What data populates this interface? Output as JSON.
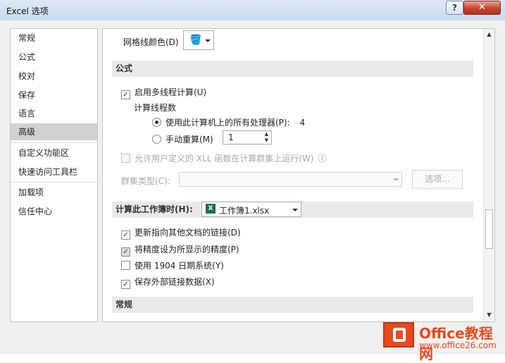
{
  "window": {
    "title": "Excel 选项",
    "help_glyph": "?",
    "close_glyph": "✕"
  },
  "sidebar": {
    "items": [
      {
        "label": "常规",
        "selected": false
      },
      {
        "label": "公式",
        "selected": false
      },
      {
        "label": "校对",
        "selected": false
      },
      {
        "label": "保存",
        "selected": false
      },
      {
        "label": "语言",
        "selected": false
      },
      {
        "label": "高级",
        "selected": true
      },
      {
        "label": "自定义功能区",
        "selected": false
      },
      {
        "label": "快速访问工具栏",
        "selected": false
      },
      {
        "label": "加载项",
        "selected": false
      },
      {
        "label": "信任中心",
        "selected": false
      }
    ]
  },
  "content": {
    "gridline_color_label": "网格线颜色(D)",
    "formula_section": "公式",
    "enable_multithread": {
      "label": "启用多线程计算(U)",
      "checked": true
    },
    "thread_count_label": "计算线程数",
    "use_all_processors": {
      "label": "使用此计算机上的所有处理器(P):",
      "value": "4",
      "selected": true
    },
    "manual": {
      "label": "手动重算(M)",
      "value": "1",
      "selected": false
    },
    "allow_xll": {
      "label": "允许用户定义的 XLL 函数在计算群集上运行(W)",
      "checked": false,
      "info_glyph": "ⓘ"
    },
    "cluster_type_label": "群集类型(C):",
    "options_button": "选项...",
    "workbook_section_label": "计算此工作簿时(H):",
    "workbook_select": "工作簿1.xlsx",
    "update_links": {
      "label": "更新指向其他文档的链接(D)",
      "checked": true
    },
    "set_precision": {
      "label": "将精度设为所显示的精度(P)",
      "checked": true
    },
    "date_1904": {
      "label": "使用 1904 日期系统(Y)",
      "checked": false
    },
    "save_external": {
      "label": "保存外部链接数据(X)",
      "checked": true
    },
    "general_section": "常规"
  },
  "scrollbar": {
    "up_glyph": "▲",
    "down_glyph": "▼"
  },
  "watermark": {
    "brand": "Office教程网",
    "url": "www.office26.com"
  },
  "colors": {
    "accent": "#e8491d",
    "selected_nav": "#d1d1d1",
    "section_bg": "#e9e9e9"
  }
}
